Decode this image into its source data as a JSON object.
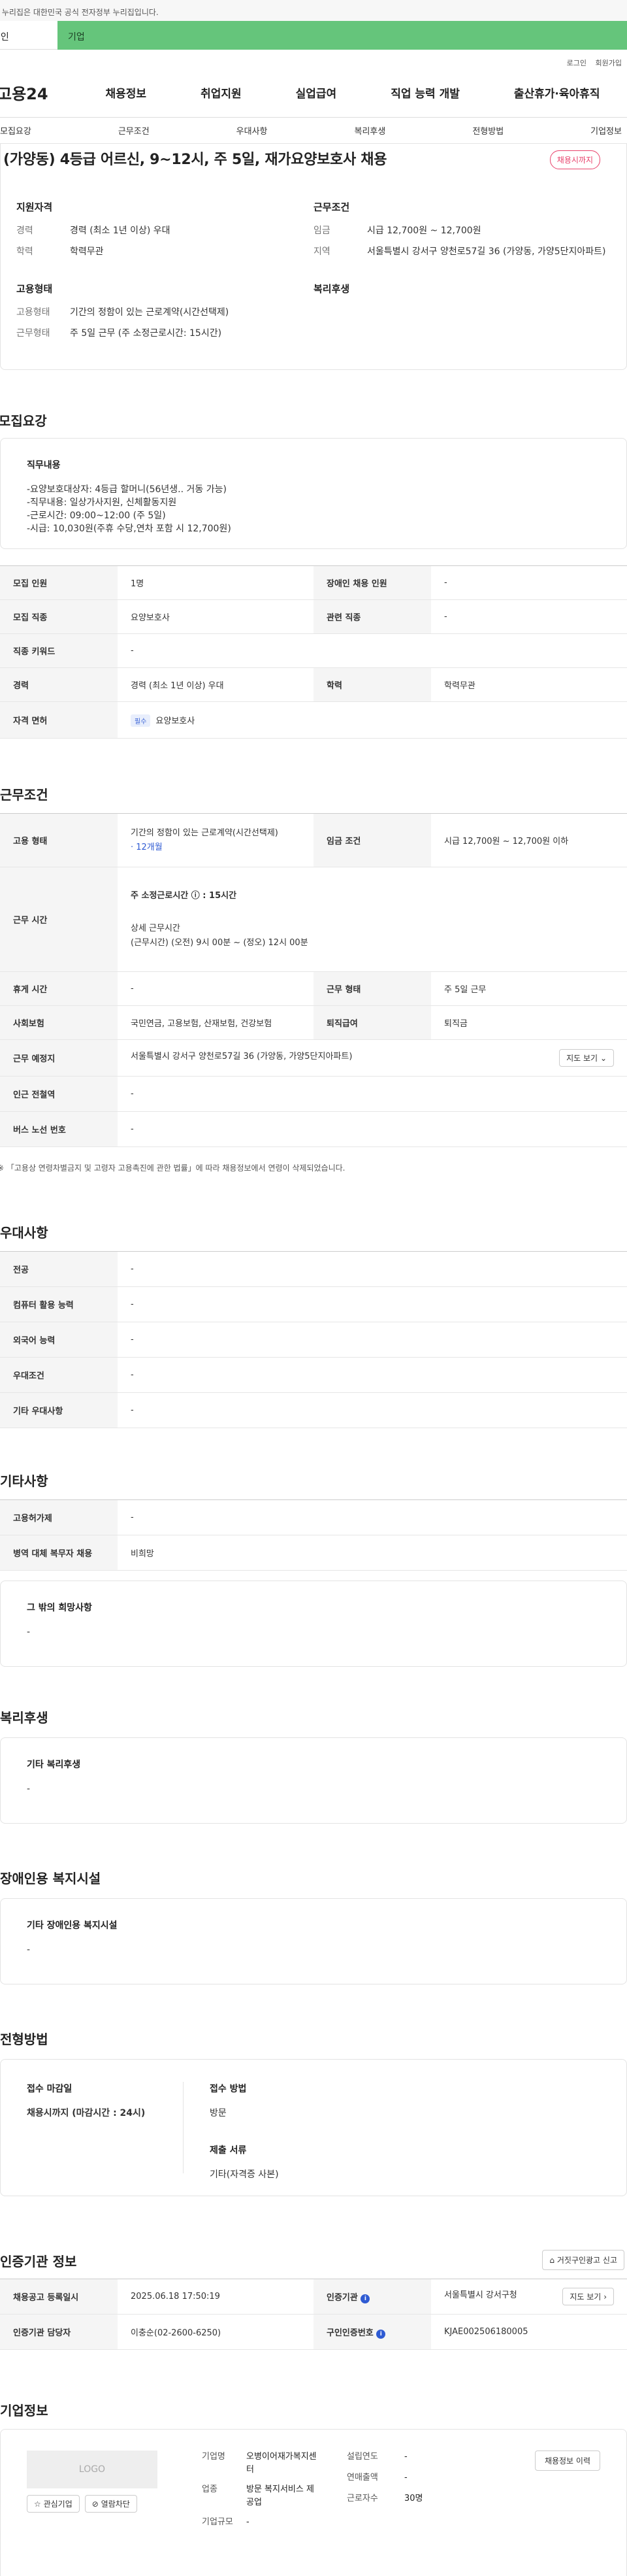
{
  "header": {
    "gov_note": "이 누리집은 대한민국 공식 전자정부 누리집입니다.",
    "tab_personal": "개인",
    "tab_company": "기업",
    "utils": [
      "로그인",
      "회원가입"
    ],
    "logo": "고용24",
    "gnb": [
      "채용정보",
      "취업지원",
      "실업급여",
      "직업 능력 개발",
      "출산휴가·육아휴직"
    ],
    "subnav": [
      "모집요강",
      "근무조건",
      "우대사항",
      "복리후생",
      "전형방법",
      "기업정보"
    ]
  },
  "summary": {
    "title": "(가양동) 4등급 어르신, 9~12시, 주 5일, 재가요양보호사 채용",
    "badge": "채용시까지",
    "qual_title": "지원자격",
    "qual": [
      {
        "k": "경력",
        "v": "경력 (최소 1년 이상) 우대"
      },
      {
        "k": "학력",
        "v": "학력무관"
      }
    ],
    "emp_title": "고용형태",
    "emp": [
      {
        "k": "고용형태",
        "v": "기간의 정함이 있는 근로계약(시간선택제)"
      },
      {
        "k": "근무형태",
        "v": "주 5일 근무 (주 소정근로시간: 15시간)"
      }
    ],
    "work_title": "근무조건",
    "work": [
      {
        "k": "임금",
        "v": "시급 12,700원 ~ 12,700원"
      },
      {
        "k": "지역",
        "v": "서울특별시 강서구 양천로57길 36 (가양동, 가양5단지아파트)"
      }
    ],
    "welfare_title": "복리후생"
  },
  "recruit": {
    "section_title": "모집요강",
    "duty_title": "직무내용",
    "duty_lines": [
      "-요양보호대상자: 4등급 할머니(56년생.. 거동 가능)",
      "-직무내용: 일상가사지원, 신체활동지원",
      "-근로시간: 09:00~12:00 (주 5일)",
      "-시급: 10,030원(주휴 수당,연차 포함 시 12,700원)"
    ],
    "rows": [
      [
        "모집 인원",
        "1명",
        "장애인 채용 인원",
        "-"
      ],
      [
        "모집 직종",
        "요양보호사",
        "관련 직종",
        "-"
      ],
      [
        "직종 키워드",
        "-"
      ],
      [
        "경력",
        "경력 (최소 1년 이상) 우대",
        "학력",
        "학력무관"
      ]
    ],
    "license_label": "자격 면허",
    "license_tag": "필수",
    "license_value": "요양보호사"
  },
  "conditions": {
    "section_title": "근무조건",
    "emp_type_label": "고용 형태",
    "emp_type_value": "기간의 정함이 있는 근로계약(시간선택제)",
    "emp_type_period": "· 12개월",
    "wage_label": "임금 조건",
    "wage_value": "시급 12,700원 ~ 12,700원 이하",
    "hours_label": "근무 시간",
    "hours_weekly": "주 소정근로시간 ⓘ : 15시간",
    "hours_detail_title": "상세 근무시간",
    "hours_detail": "(근무시간) (오전) 9시 00분 ~ (정오) 12시 00분",
    "rows": [
      [
        "휴게 시간",
        "-",
        "근무 형태",
        "주 5일 근무"
      ],
      [
        "사회보험",
        "국민연금, 고용보험, 산재보험, 건강보험",
        "퇴직급여",
        "퇴직금"
      ]
    ],
    "place_label": "근무 예정지",
    "place_value": "서울특별시 강서구 양천로57길 36 (가양동, 가양5단지아파트)",
    "map_btn": "지도 보기",
    "subway_label": "인근 전철역",
    "subway_value": "-",
    "bus_label": "버스 노선 번호",
    "bus_value": "-",
    "note": "※ 「고용상 연령차별금지 및 고령자 고용촉진에 관한 법률」에 따라 채용정보에서 연령이 삭제되었습니다."
  },
  "preference": {
    "section_title": "우대사항",
    "rows": [
      [
        "전공",
        "-"
      ],
      [
        "컴퓨터 활용 능력",
        "-"
      ],
      [
        "외국어 능력",
        "-"
      ],
      [
        "우대조건",
        "-"
      ],
      [
        "기타 우대사항",
        "-"
      ]
    ]
  },
  "other": {
    "section_title": "기타사항",
    "rows": [
      [
        "고용허가제",
        "-"
      ],
      [
        "병역 대체 복무자 채용",
        "비희망"
      ]
    ],
    "etc_title": "그 밖의 희망사항",
    "etc_value": "-"
  },
  "welfare": {
    "section_title": "복리후생",
    "box_title": "기타 복리후생",
    "box_value": "-"
  },
  "facility": {
    "section_title": "장애인용 복지시설",
    "box_title": "기타 장애인용 복지시설",
    "box_value": "-"
  },
  "process": {
    "section_title": "전형방법",
    "deadline_title": "접수 마감일",
    "deadline_value": "채용시까지 (마감시간 : 24시)",
    "method_title": "접수 방법",
    "method_value": "방문",
    "docs_title": "제출 서류",
    "docs_value": "기타(자격증 사본)"
  },
  "cert": {
    "section_title": "인증기관 정보",
    "report_btn": "거짓구인광고 신고",
    "reg_label": "채용공고 등록일시",
    "reg_value": "2025.06.18 17:50:19",
    "org_label": "인증기관",
    "org_value": "서울특별시 강서구청",
    "map_btn": "지도 보기",
    "manager_label": "인증기관 담당자",
    "manager_value": "이충순(02-2600-6250)",
    "cert_no_label": "구인인증번호",
    "cert_no_value": "KJAE002506180005"
  },
  "company": {
    "section_title": "기업정보",
    "logo_text": "LOGO",
    "interest_btn": "관심기업",
    "block_btn": "열람차단",
    "name_label": "기업명",
    "name_value": "오병이어재가복지센터",
    "industry_label": "업종",
    "industry_value": "방문 복지서비스 제공업",
    "size_label": "기업규모",
    "size_value": "-",
    "founded_label": "설립연도",
    "founded_value": "-",
    "revenue_label": "연매출액",
    "revenue_value": "-",
    "employees_label": "근로자수",
    "employees_value": "30명",
    "history_btn": "채용정보 이력"
  }
}
